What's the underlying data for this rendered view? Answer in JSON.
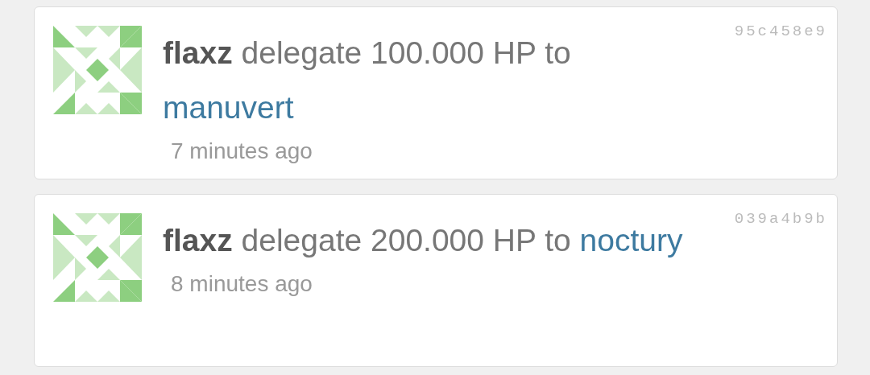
{
  "operations": [
    {
      "actor": "flaxz",
      "action": "delegate 100.000 HP to",
      "target": "manuvert",
      "time": "7 minutes ago",
      "hash": "95c458e9"
    },
    {
      "actor": "flaxz",
      "action": "delegate 200.000 HP to",
      "target": "noctury",
      "time": "8 minutes ago",
      "hash": "039a4b9b"
    }
  ]
}
